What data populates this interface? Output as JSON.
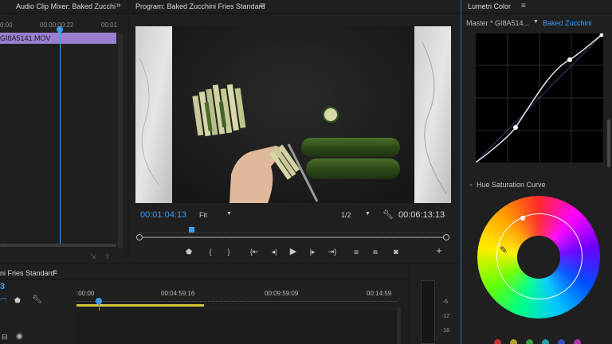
{
  "source_panel": {
    "tab_label": "Audio Clip Mixer: Baked Zucchi",
    "ruler": [
      "0:00",
      "00:00:00:22",
      "00:01"
    ],
    "clip_name": "GI8A5141.MOV"
  },
  "program": {
    "title": "Program: Baked Zucchini Fries Standard",
    "current_timecode": "00:01:04:13",
    "zoom": "Fit",
    "resolution": "1/2",
    "duration_timecode": "00:06:13:13",
    "playhead_fraction": 0.17
  },
  "lumetri": {
    "title": "Lumetri Color",
    "master_label": "Master * GI8A514...",
    "clip_label": "Baked Zucchini",
    "hue_sat_label": "Hue Saturation Curve"
  },
  "timeline": {
    "title": "ni Fries Standard",
    "current_timecode_partial": "3",
    "ruler": [
      ":00:00",
      "00:04:59:16",
      "00:09:59:09",
      "00:14:59"
    ]
  },
  "meter": {
    "ticks": [
      "-6",
      "-12",
      "-18"
    ]
  },
  "icons": {
    "menu": "hamburger-menu-icon",
    "expand": "double-chevron-icon",
    "wrench": "wrench-icon",
    "marker": "marker-icon",
    "camera": "camera-icon",
    "add": "plus-icon",
    "eyedropper": "eyedropper-icon"
  },
  "colors": {
    "accent_blue": "#3d9bf0",
    "clip_purple": "#9a7fd0",
    "work_area_yellow": "#d4c53a"
  }
}
